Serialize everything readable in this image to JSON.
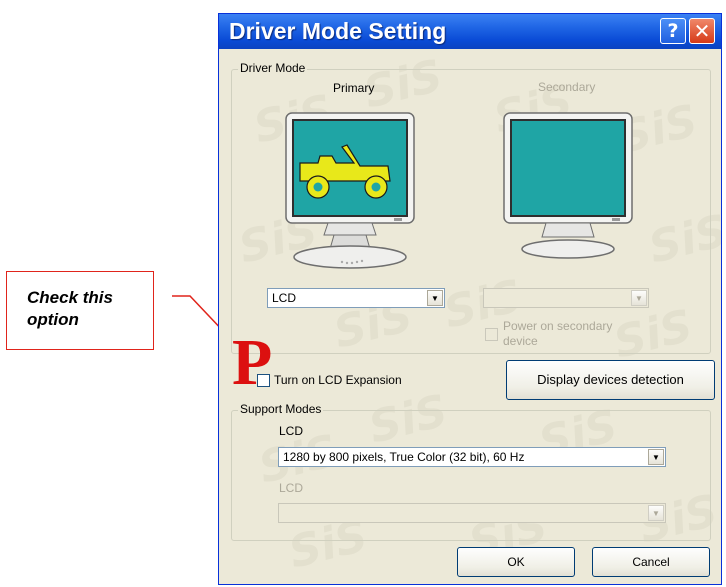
{
  "callout": {
    "text_line1": "Check this",
    "text_line2": "option",
    "marker": "P"
  },
  "dialog": {
    "title": "Driver Mode Setting",
    "help_icon": "?",
    "close_icon": "✕",
    "watermark": "SiS"
  },
  "driver_mode": {
    "group_label": "Driver Mode",
    "primary": {
      "label": "Primary",
      "select_value": "LCD",
      "screen_color": "#1fa5a5",
      "jeep_color": "#e8e81a"
    },
    "secondary": {
      "label": "Secondary",
      "select_value": "",
      "screen_color": "#1fa5a5"
    },
    "power_secondary": {
      "line1": "Power on secondary",
      "line2": "device",
      "checked": false
    },
    "lcd_expansion": {
      "label": "Turn on LCD Expansion",
      "checked": false
    },
    "detect_button": "Display devices detection"
  },
  "support_modes": {
    "group_label": "Support Modes",
    "primary_label": "LCD",
    "primary_value": "1280 by 800 pixels, True Color (32 bit), 60 Hz",
    "secondary_label": "LCD",
    "secondary_value": ""
  },
  "buttons": {
    "ok": "OK",
    "cancel": "Cancel"
  }
}
